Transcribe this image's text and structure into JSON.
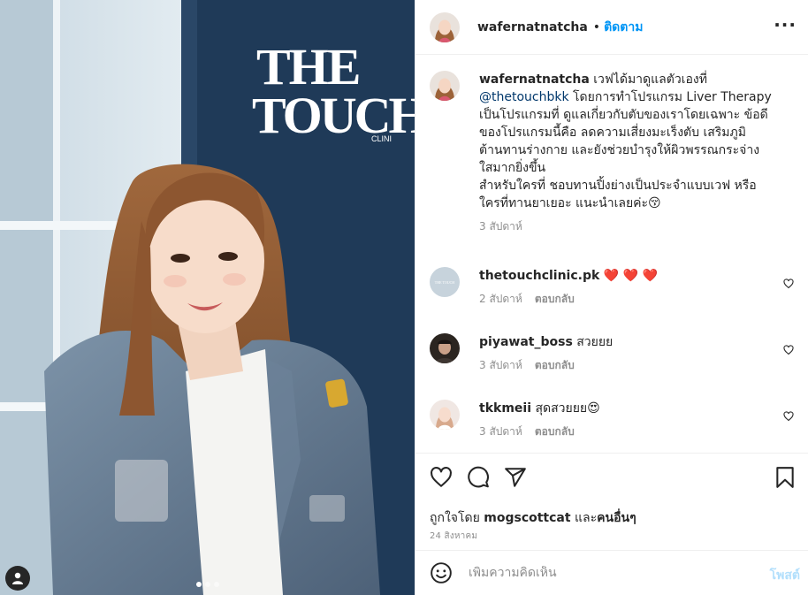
{
  "photo": {
    "sign_line1": "THE",
    "sign_line2": "TOUCH",
    "sign_line3": "CLINI",
    "carousel_count": 3,
    "carousel_active": 1
  },
  "post": {
    "username": "wafernatnatcha",
    "separator": "•",
    "follow_label": "ติดตาม",
    "more_icon": "more-horizontal-icon",
    "caption_user": "wafernatnatcha",
    "caption_line1": " เวฟได้มาดูแลตัวเองที่",
    "caption_mention": "@thetouchbkk",
    "caption_line2": " โดยการทำโปรแกรม Liver Therapy",
    "caption_line3": "เป็นโปรแกรมที่ ดูแลเกี่ยวกับตับของเราโดยเฉพาะ ข้อดี",
    "caption_line4": "ของโปรแกรมนี้คือ ลดความเสี่ยงมะเร็งตับ เสริมภูมิ",
    "caption_line5": "ต้านทานร่างกาย และยังช่วยบำรุงให้ผิวพรรณกระจ่าง",
    "caption_line6": "ใสมากยิ่งขึ้น",
    "caption_line7": "สำหรับใครที่ ชอบทานปิ้งย่างเป็นประจำแบบเวฟ หรือ",
    "caption_line8": "ใครที่ทานยาเยอะ แนะนำเลยค่ะ😚",
    "caption_time": "3 สัปดาห์"
  },
  "comments": [
    {
      "user": "thetouchclinic.pk",
      "text": " ❤️ ❤️ ❤️",
      "time": "2 สัปดาห์",
      "reply": "ตอบกลับ",
      "avatar_text": "THE TOUCH"
    },
    {
      "user": "piyawat_boss",
      "text": " สวยยย",
      "time": "3 สัปดาห์",
      "reply": "ตอบกลับ"
    },
    {
      "user": "tkkmeii",
      "text": " สุดสวยยย😍",
      "time": "3 สัปดาห์",
      "reply": "ตอบกลับ"
    }
  ],
  "actions": {
    "icons": [
      "heart-icon",
      "comment-icon",
      "share-icon",
      "bookmark-icon"
    ],
    "likes_prefix": "ถูกใจโดย ",
    "likes_user": "mogscottcat",
    "likes_mid": " และ",
    "likes_others": "คนอื่นๆ",
    "date": "24 สิงหาคม"
  },
  "composer": {
    "placeholder": "เพิ่มความคิดเห็น",
    "post_label": "โพสต์",
    "emoji_icon": "smiley-icon"
  },
  "colors": {
    "link": "#0095f6",
    "post_disabled": "#b2dffc",
    "mention": "#00376b",
    "heart_red": "#ed4956"
  }
}
